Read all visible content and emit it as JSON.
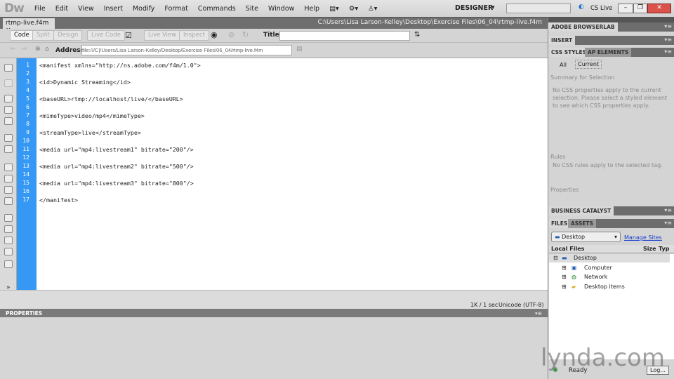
{
  "app": {
    "logo": "Dw",
    "menus": [
      "File",
      "Edit",
      "View",
      "Insert",
      "Modify",
      "Format",
      "Commands",
      "Site",
      "Window",
      "Help"
    ],
    "workspace": "DESIGNER",
    "search_placeholder": "",
    "cs_live": "CS Live"
  },
  "document": {
    "tab": "rtmp-live.f4m",
    "path": "C:\\Users\\Lisa Larson-Kelley\\Desktop\\Exercise Files\\06_04\\rtmp-live.f4m"
  },
  "toolbar": {
    "code": "Code",
    "split": "Split",
    "design": "Design",
    "live_code": "Live Code",
    "live_view": "Live View",
    "inspect": "Inspect",
    "title_label": "Title:",
    "title_value": ""
  },
  "address": {
    "label": "Address:",
    "value": "file:///C|/Users/Lisa Larson-Kelley/Desktop/Exercise Files/06_04/rtmp-live.f4m"
  },
  "code_lines": [
    "<manifest xmlns=\"http://ns.adobe.com/f4m/1.0\">",
    "",
    "<id>Dynamic Streaming</id>",
    "",
    "<baseURL>rtmp://localhost/live/</baseURL>",
    "",
    "<mimeType>video/mp4</mimeType>",
    "",
    "<streamType>live</streamType>",
    "",
    "<media url=\"mp4:livestream1\" bitrate=\"200\"/>",
    "",
    "<media url=\"mp4:livestream2\" bitrate=\"500\"/>",
    "",
    "<media url=\"mp4:livestream3\" bitrate=\"800\"/>",
    "",
    "</manifest>"
  ],
  "status": {
    "size": "1K / 1 sec",
    "encoding": "Unicode (UTF-8)"
  },
  "properties": {
    "title": "PROPERTIES"
  },
  "panels": {
    "browserlab": "ADOBE BROWSERLAB",
    "insert": "INSERT",
    "css_styles": "CSS STYLES",
    "ap_elements": "AP ELEMENTS",
    "all": "All",
    "current": "Current",
    "summary_title": "Summary for Selection",
    "summary_text": "No CSS properties apply to the current selection.  Please select a styled element to see which CSS properties apply.",
    "rules_title": "Rules",
    "rules_text": "No CSS rules apply to the selected tag.",
    "properties_title": "Properties",
    "business_catalyst": "BUSINESS CATALYST",
    "files": "FILES",
    "assets": "ASSETS",
    "site": "Desktop",
    "manage_sites": "Manage Sites",
    "col_local": "Local Files",
    "col_size": "Size",
    "col_type": "Typ",
    "tree": [
      {
        "label": "Desktop"
      },
      {
        "label": "Computer"
      },
      {
        "label": "Network"
      },
      {
        "label": "Desktop items"
      }
    ],
    "ready": "Ready",
    "log": "Log..."
  },
  "watermark": "lynda.com"
}
